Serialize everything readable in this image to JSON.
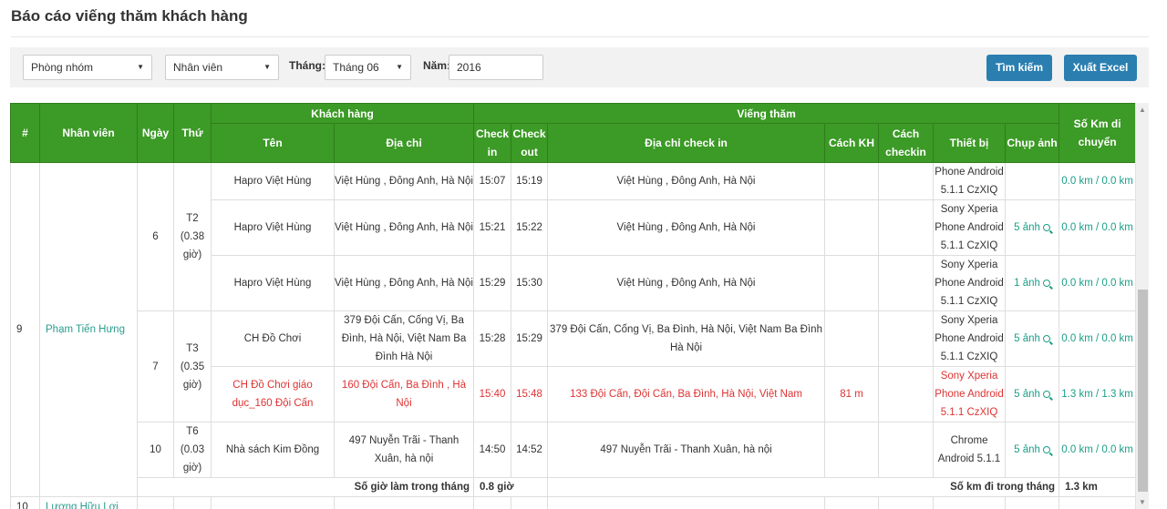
{
  "page": {
    "title": "Báo cáo viếng thăm khách hàng"
  },
  "filters": {
    "group_select": "Phòng nhóm",
    "staff_select": "Nhân viên",
    "month_label": "Tháng:",
    "month_select": "Tháng 06",
    "year_label": "Năm:",
    "year_value": "2016",
    "search_button": "Tìm kiếm",
    "export_button": "Xuất Excel"
  },
  "table": {
    "headers": {
      "num": "#",
      "staff": "Nhân viên",
      "day": "Ngày",
      "weekday": "Thứ",
      "customer_group": "Khách hàng",
      "visit_group": "Viếng thăm",
      "km": "Số Km di chuyển",
      "name": "Tên",
      "address": "Địa chỉ",
      "checkin": "Check in",
      "checkout": "Check out",
      "checkin_address": "Địa chỉ check in",
      "distance_kh": "Cách KH",
      "distance_checkin": "Cách checkin",
      "device": "Thiết bị",
      "photo": "Chụp ảnh"
    },
    "staff_row": {
      "num": "9",
      "name": "Phạm Tiến Hưng"
    },
    "groups": [
      {
        "day": "6",
        "weekday": "T2 (0.38 giờ)"
      },
      {
        "day": "7",
        "weekday": "T3 (0.35 giờ)"
      },
      {
        "day": "10",
        "weekday": "T6 (0.03 giờ)"
      }
    ],
    "rows": [
      {
        "name": "Hapro Việt Hùng",
        "address": "Việt Hùng , Đông Anh, Hà Nội",
        "in": "15:07",
        "out": "15:19",
        "ci_addr": "Việt Hùng , Đông Anh, Hà Nội",
        "kh": "",
        "ck": "",
        "device": "Phone Android 5.1.1 CzXIQ",
        "photo": "",
        "km": "0.0 km / 0.0 km"
      },
      {
        "name": "Hapro Việt Hùng",
        "address": "Việt Hùng , Đông Anh, Hà Nội",
        "in": "15:21",
        "out": "15:22",
        "ci_addr": "Việt Hùng , Đông Anh, Hà Nội",
        "kh": "",
        "ck": "",
        "device": "Sony Xperia Phone Android 5.1.1 CzXIQ",
        "photo": "5 ảnh",
        "km": "0.0 km / 0.0 km"
      },
      {
        "name": "Hapro Việt Hùng",
        "address": "Việt Hùng , Đông Anh, Hà Nội",
        "in": "15:29",
        "out": "15:30",
        "ci_addr": "Việt Hùng , Đông Anh, Hà Nội",
        "kh": "",
        "ck": "",
        "device": "Sony Xperia Phone Android 5.1.1 CzXIQ",
        "photo": "1 ảnh",
        "km": "0.0 km / 0.0 km"
      },
      {
        "name": "CH Đồ Chơi",
        "address": "379 Đội Cấn, Cống Vị, Ba Đình, Hà Nội, Việt Nam Ba Đình Hà Nội",
        "in": "15:28",
        "out": "15:29",
        "ci_addr": "379 Đội Cấn, Cống Vị, Ba Đình, Hà Nội, Việt Nam Ba Đình Hà Nội",
        "kh": "",
        "ck": "",
        "device": "Sony Xperia Phone Android 5.1.1 CzXIQ",
        "photo": "5 ảnh",
        "km": "0.0 km / 0.0 km"
      },
      {
        "name": "CH Đồ Chơi giáo dục_160 Đội Cấn",
        "address": "160 Đội Cấn, Ba Đình , Hà Nội",
        "in": "15:40",
        "out": "15:48",
        "ci_addr": "133 Đội Cấn, Đội Cấn, Ba Đình, Hà Nội, Việt Nam",
        "kh": "81 m",
        "ck": "",
        "device": "Sony Xperia Phone Android 5.1.1 CzXIQ",
        "photo": "5 ảnh",
        "km": "1.3 km / 1.3 km"
      },
      {
        "name": "Nhà sách Kim Đồng",
        "address": "497 Nuyễn Trãi - Thanh Xuân, hà nội",
        "in": "14:50",
        "out": "14:52",
        "ci_addr": "497 Nuyễn Trãi - Thanh Xuân, hà nội",
        "kh": "",
        "ck": "",
        "device": "Chrome Android 5.1.1",
        "photo": "5 ảnh",
        "km": "0.0 km / 0.0 km"
      }
    ],
    "summary": {
      "hours_label": "Số giờ làm trong tháng",
      "hours_value": "0.8 giờ",
      "km_label": "Số km đi trong tháng",
      "km_value": "1.3 km"
    },
    "next_staff": {
      "num": "10",
      "name": "Lương Hữu Lợi"
    }
  }
}
